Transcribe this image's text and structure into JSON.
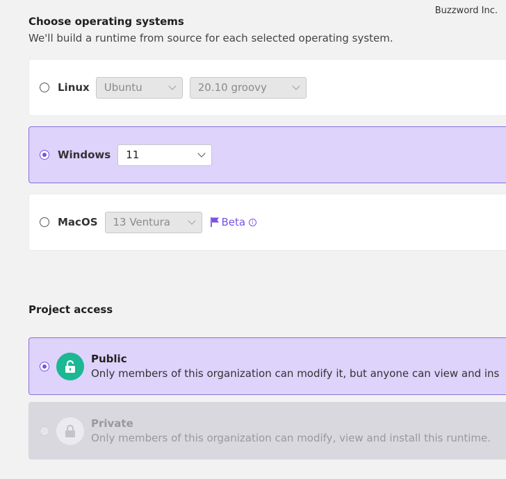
{
  "watermark": "Buzzword Inc.",
  "os_section": {
    "title": "Choose operating systems",
    "subtitle": "We'll build a runtime from source for each selected operating system.",
    "options": [
      {
        "label": "Linux",
        "selected": false,
        "selects": [
          "Ubuntu",
          "20.10 groovy"
        ]
      },
      {
        "label": "Windows",
        "selected": true,
        "selects": [
          "11"
        ]
      },
      {
        "label": "MacOS",
        "selected": false,
        "selects": [
          "13 Ventura"
        ],
        "badge": "Beta",
        "info_icon": "info-icon"
      }
    ]
  },
  "access_section": {
    "title": "Project access",
    "options": [
      {
        "title": "Public",
        "description": "Only members of this organization can modify it, but anyone can view and ins",
        "selected": true,
        "icon": "unlocked-lock-icon"
      },
      {
        "title": "Private",
        "description": "Only members of this organization can modify, view and install this runtime.",
        "selected": false,
        "disabled": true,
        "icon": "lock-icon"
      }
    ]
  },
  "colors": {
    "accent": "#7a52e0",
    "selected_bg": "#ddd3fb",
    "public_icon_bg": "#1bb893"
  }
}
